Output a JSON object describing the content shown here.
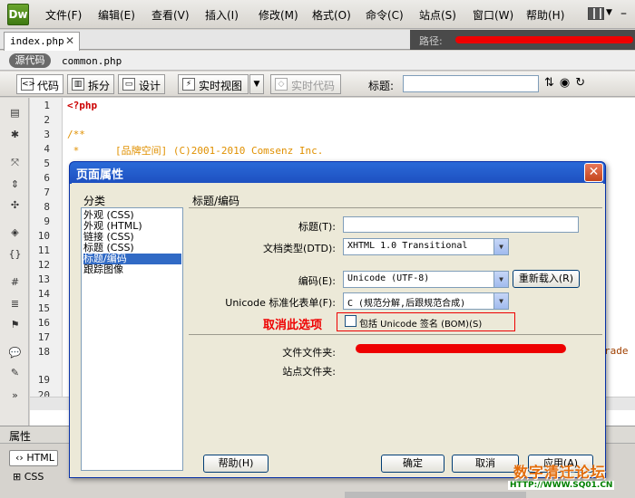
{
  "app": {
    "logo": "Dw"
  },
  "menu": [
    "文件(F)",
    "编辑(E)",
    "查看(V)",
    "插入(I)",
    "修改(M)",
    "格式(O)",
    "命令(C)",
    "站点(S)",
    "窗口(W)",
    "帮助(H)"
  ],
  "document": {
    "tab_name": "index.php",
    "path_label": "路径:"
  },
  "related_files": {
    "source_code": "源代码",
    "file": "common.php"
  },
  "toolbar": {
    "code": "代码",
    "split": "拆分",
    "design": "设计",
    "live_view": "实时视图",
    "live_code": "实时代码",
    "title_label": "标题:",
    "title_value": ""
  },
  "editor": {
    "line_numbers": [
      "1",
      "2",
      "3",
      "4",
      "5",
      "6",
      "7",
      "8",
      "9",
      "10",
      "11",
      "12",
      "13",
      "14",
      "15",
      "16",
      "17",
      "18",
      "19",
      "20"
    ],
    "lines": [
      "<?php",
      "",
      "/**",
      " *      [品牌空间] (C)2001-2010 Comsenz Inc."
    ],
    "trailing_fragment": "rade"
  },
  "properties_panel": {
    "title": "属性",
    "html": "HTML",
    "css": "CSS"
  },
  "dialog": {
    "title": "页面属性",
    "category_heading": "分类",
    "categories": [
      "外观 (CSS)",
      "外观 (HTML)",
      "链接 (CSS)",
      "标题 (CSS)",
      "标题/编码",
      "跟踪图像"
    ],
    "selected_category": "标题/编码",
    "section_title": "标题/编码",
    "title_label": "标题(T):",
    "title_value": "",
    "doctype_label": "文档类型(DTD):",
    "doctype_value": "XHTML 1.0 Transitional",
    "encoding_label": "编码(E):",
    "encoding_value": "Unicode (UTF-8)",
    "reload_button": "重新载入(R)",
    "unicode_norm_label": "Unicode 标准化表单(F):",
    "unicode_norm_value": "C (规范分解,后跟规范合成)",
    "bom_checkbox": "包括 Unicode 签名 (BOM)(S)",
    "bom_checked": false,
    "annotation": "取消此选项",
    "doc_folder_label": "文件文件夹:",
    "site_folder_label": "站点文件夹:",
    "help_button": "帮助(H)",
    "ok_button": "确定",
    "cancel_button": "取消",
    "apply_button": "应用(A)"
  },
  "watermark": {
    "main": "数字清迁论坛",
    "url": "HTTP://WWW.SQ01.CN"
  },
  "colors": {
    "dialog_title": "#1d4fc0",
    "annotation": "#e00000",
    "selection": "#316ac5"
  }
}
